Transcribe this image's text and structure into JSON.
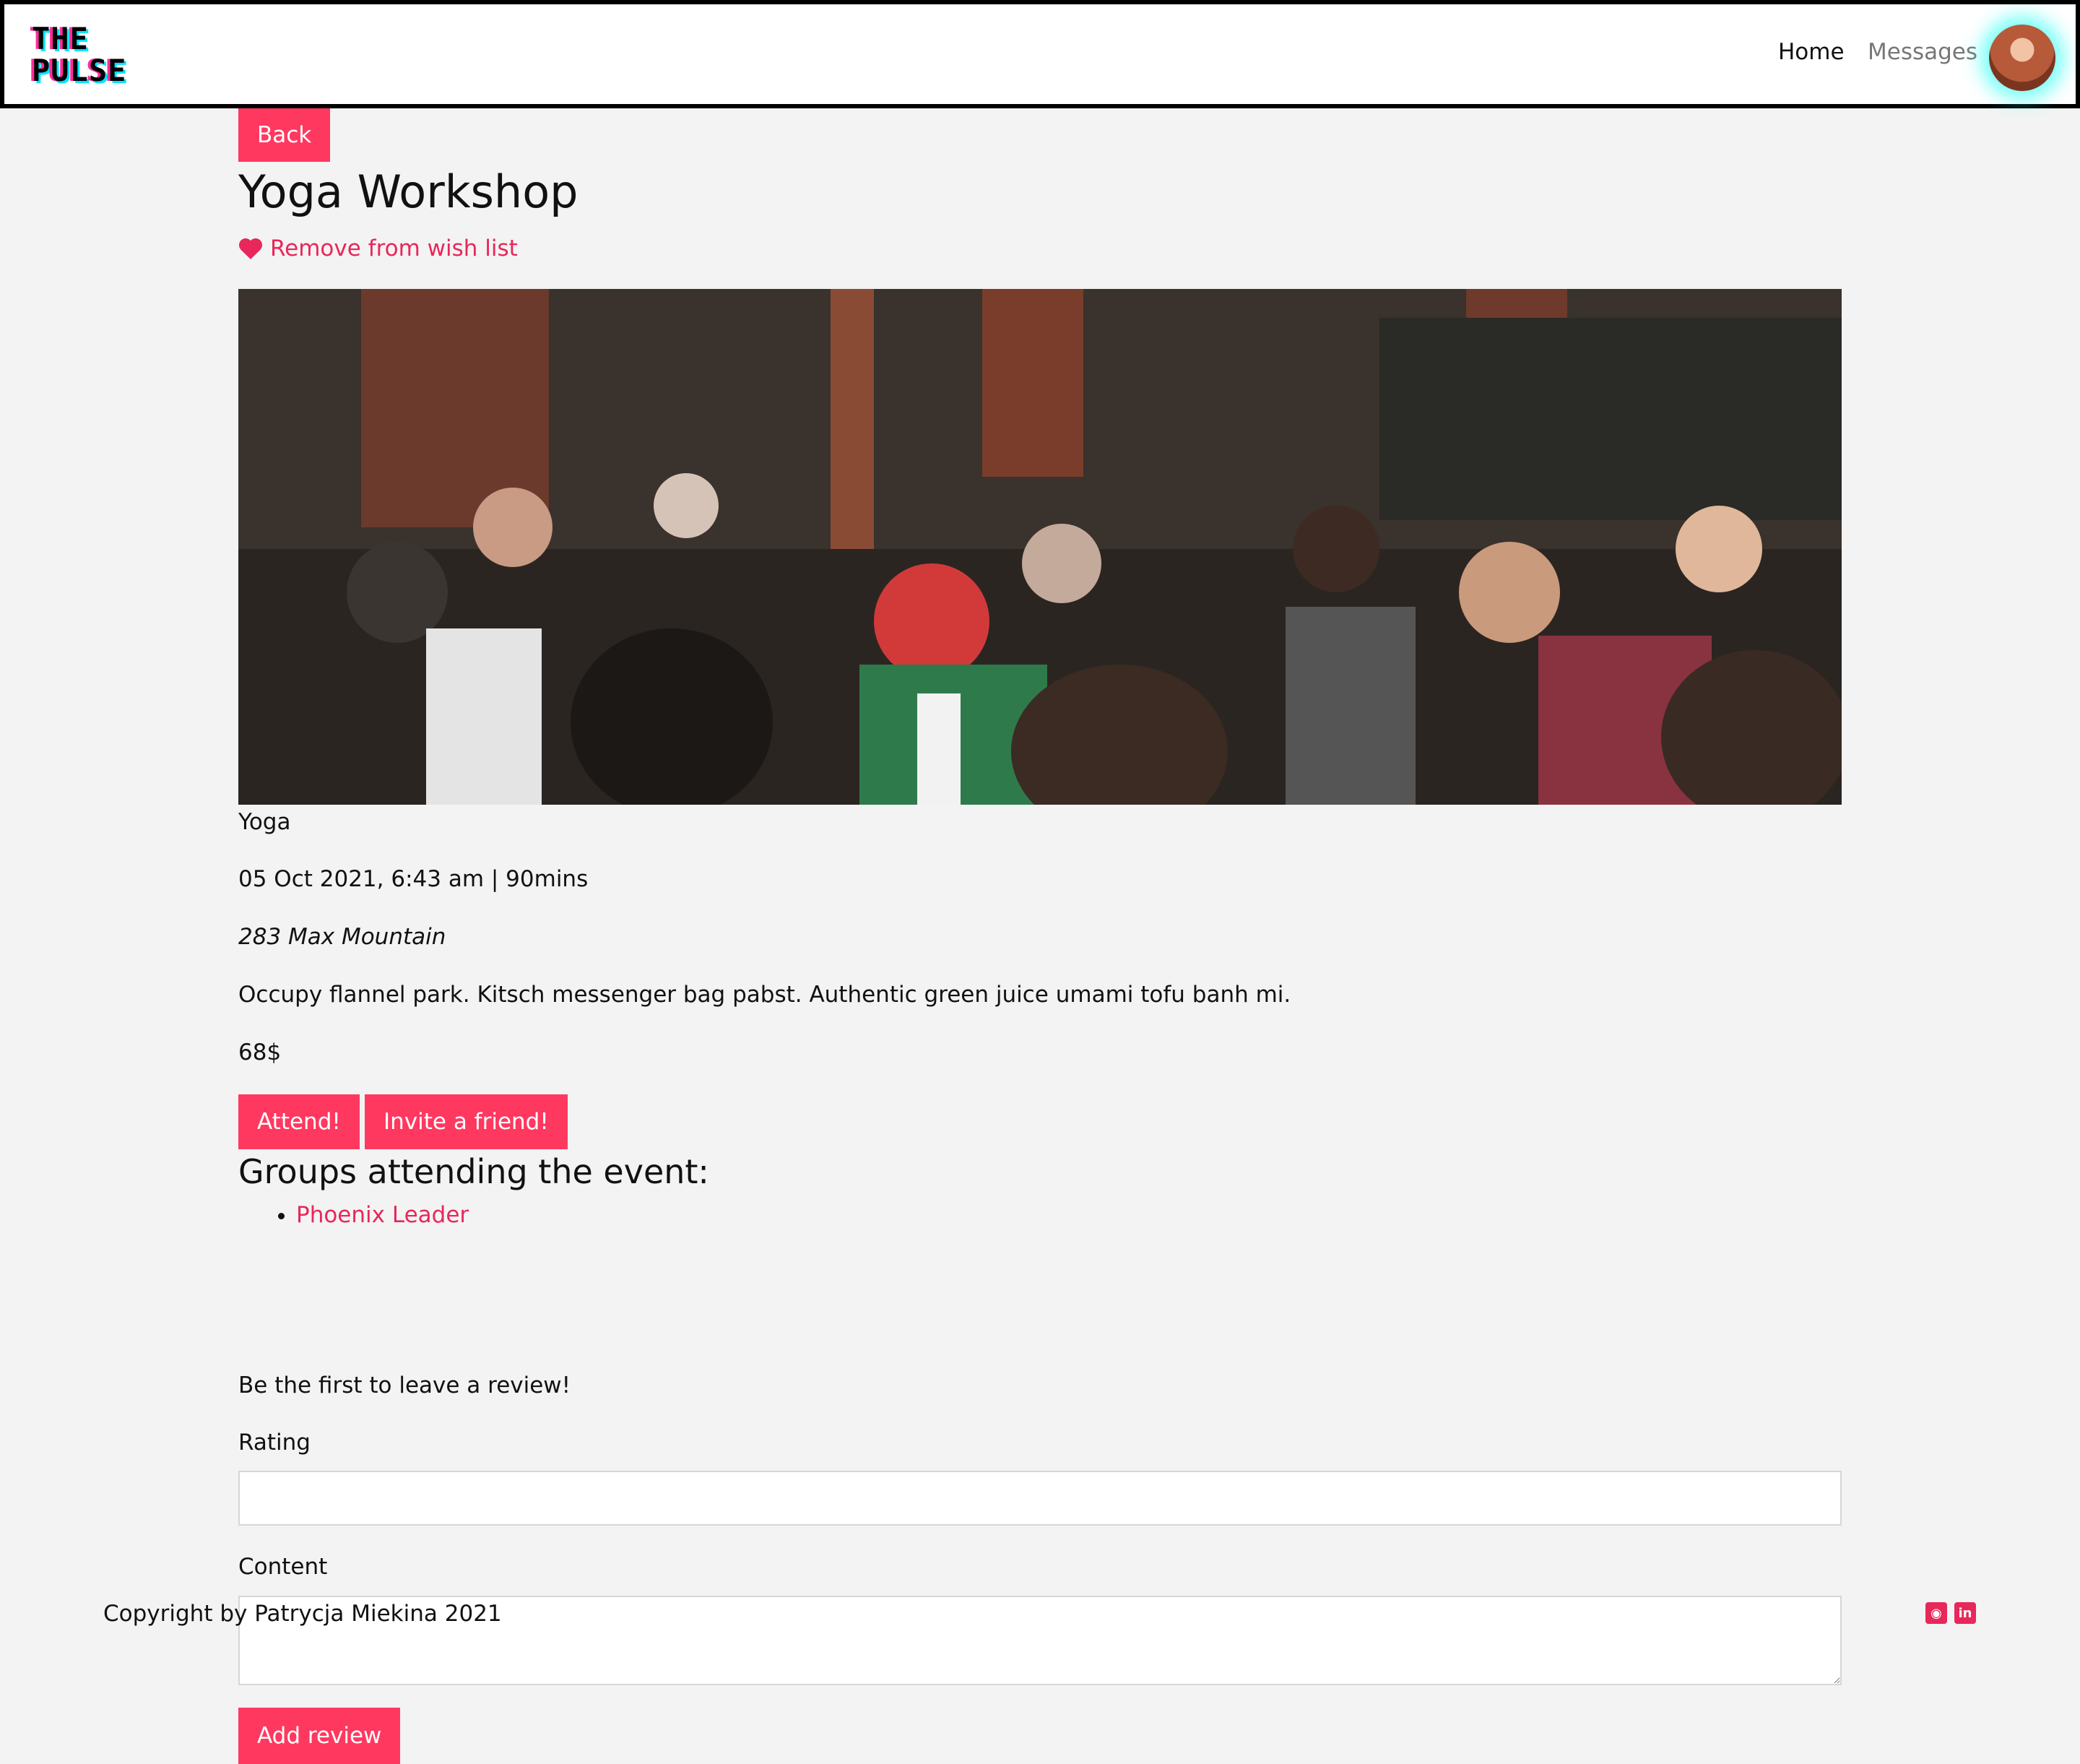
{
  "nav": {
    "logo_line1": "THE",
    "logo_line2": "PULSE",
    "home": "Home",
    "messages": "Messages"
  },
  "event": {
    "back_label": "Back",
    "title": "Yoga Workshop",
    "wishlist_label": "Remove from wish list",
    "category": "Yoga",
    "datetime": "05 Oct 2021, 6:43 am | 90mins",
    "address": "283 Max Mountain",
    "description": "Occupy flannel park. Kitsch messenger bag pabst. Authentic green juice umami tofu banh mi.",
    "price": "68$",
    "attend_label": "Attend!",
    "invite_label": "Invite a friend!"
  },
  "groups": {
    "heading": "Groups attending the event:",
    "items": [
      "Phoenix Leader"
    ]
  },
  "review": {
    "note": "Be the first to leave a review!",
    "rating_label": "Rating",
    "content_label": "Content",
    "submit_label": "Add review"
  },
  "footer": {
    "copyright": "Copyright by Patrycja Miekina 2021",
    "icons": [
      "github-icon",
      "linkedin-icon"
    ]
  },
  "colors": {
    "accent": "#ff3860",
    "link": "#e8275a",
    "background": "#f3f3f3"
  }
}
